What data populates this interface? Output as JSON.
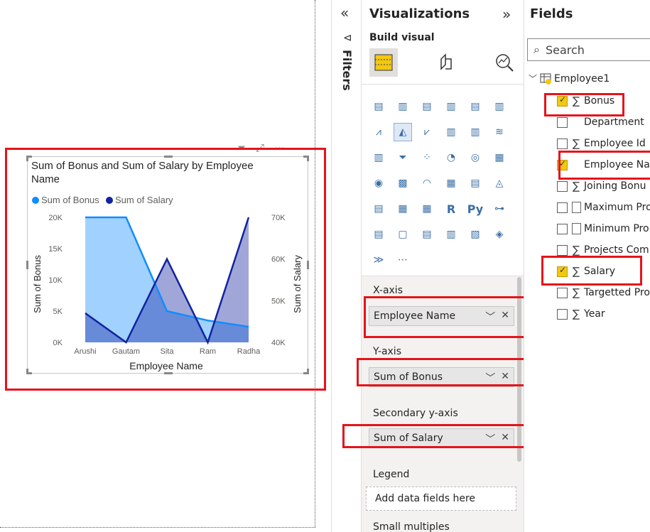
{
  "colors": {
    "bonus": "#118dff",
    "salary": "#12239e",
    "highlight": "#e5141a",
    "accent": "#f2c811"
  },
  "visual": {
    "title": "Sum of Bonus and Sum of Salary by Employee Name",
    "legend": {
      "bonus": "Sum of Bonus",
      "salary": "Sum of Salary"
    },
    "header_icons": [
      "filter-icon",
      "focus-mode-icon",
      "more-options-icon"
    ]
  },
  "chart_data": {
    "type": "area",
    "title": "Sum of Bonus and Sum of Salary by Employee Name",
    "categories": [
      "Arushi",
      "Gautam",
      "Sita",
      "Ram",
      "Radha"
    ],
    "xlabel": "Employee Name",
    "ylabel": "Sum of Bonus",
    "y2label": "Sum of Salary",
    "ylim": [
      0,
      20000
    ],
    "y2lim": [
      40000,
      70000
    ],
    "yticks": [
      "20K",
      "15K",
      "10K",
      "5K",
      "0K"
    ],
    "y2ticks": [
      "70K",
      "60K",
      "50K",
      "40K"
    ],
    "legend_position": "top-left",
    "grid": false,
    "series": [
      {
        "name": "Sum of Bonus",
        "axis": "primary",
        "values": [
          20000,
          20000,
          5000,
          3500,
          2500
        ]
      },
      {
        "name": "Sum of Salary",
        "axis": "secondary",
        "values": [
          47000,
          40000,
          60000,
          40000,
          70000
        ]
      }
    ]
  },
  "filters": {
    "label": "Filters"
  },
  "viz": {
    "title": "Visualizations",
    "build_visual": "Build visual",
    "tabs": [
      "build-visual-icon",
      "format-visual-icon",
      "analytics-icon"
    ],
    "x_axis": {
      "label": "X-axis",
      "field": "Employee Name"
    },
    "y_axis": {
      "label": "Y-axis",
      "field": "Sum of Bonus"
    },
    "y2_axis": {
      "label": "Secondary y-axis",
      "field": "Sum of Salary"
    },
    "legend": {
      "label": "Legend",
      "placeholder": "Add data fields here"
    },
    "small_multiples": {
      "label": "Small multiples"
    }
  },
  "fields": {
    "title": "Fields",
    "search_placeholder": "Search",
    "table": "Employee1",
    "items": [
      {
        "name": "Bonus",
        "sigma": true,
        "checked": true
      },
      {
        "name": "Department",
        "sigma": false,
        "checked": false
      },
      {
        "name": "Employee Id",
        "sigma": true,
        "checked": false
      },
      {
        "name": "Employee Na",
        "sigma": false,
        "checked": true
      },
      {
        "name": "Joining Bonu",
        "sigma": true,
        "checked": false
      },
      {
        "name": "Maximum Pro",
        "sigma": false,
        "calc": true,
        "checked": false
      },
      {
        "name": "Minimum Pro",
        "sigma": false,
        "calc": true,
        "checked": false
      },
      {
        "name": "Projects Com",
        "sigma": true,
        "checked": false
      },
      {
        "name": "Salary",
        "sigma": true,
        "checked": true
      },
      {
        "name": "Targetted Pro",
        "sigma": true,
        "checked": false
      },
      {
        "name": "Year",
        "sigma": true,
        "checked": false
      }
    ]
  }
}
